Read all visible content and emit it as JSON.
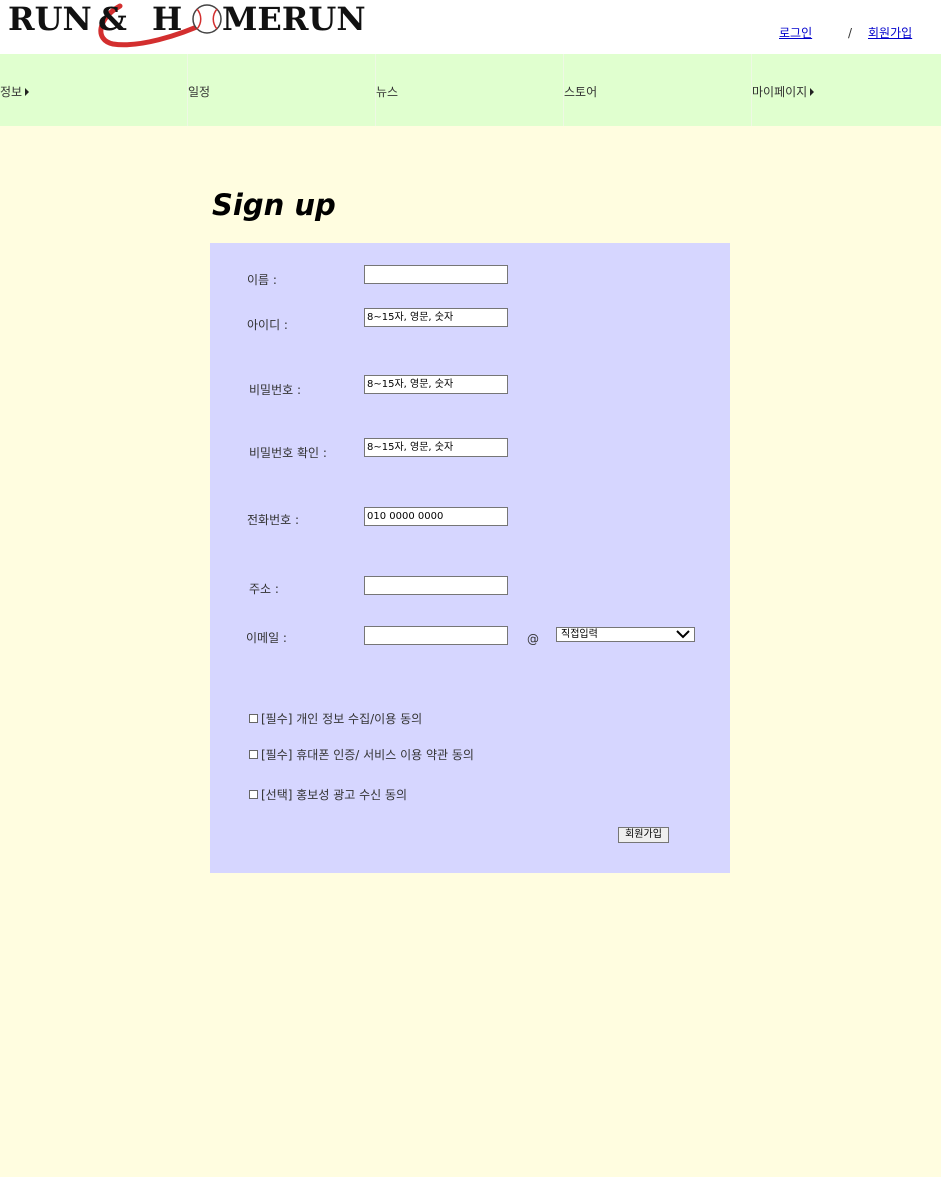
{
  "header": {
    "logo": {
      "text_left": "RUN",
      "text_amp": "&",
      "text_h": "H",
      "text_right": "MERUN",
      "accent_color": "#d32f2f"
    },
    "login_link": "로그인",
    "separator": "/",
    "signup_link": "회원가입"
  },
  "nav": {
    "items": [
      {
        "label": "정보",
        "has_submenu": true
      },
      {
        "label": "일정",
        "has_submenu": false
      },
      {
        "label": "뉴스",
        "has_submenu": false
      },
      {
        "label": "스토어",
        "has_submenu": false
      },
      {
        "label": "마이페이지",
        "has_submenu": true
      }
    ]
  },
  "page": {
    "title": "Sign up"
  },
  "form": {
    "name_label": "이름 :",
    "id_label": "아이디 :",
    "id_placeholder": "8~15자, 영문, 숫자",
    "password_label": "비밀번호 :",
    "password_placeholder": "8~15자, 영문, 숫자",
    "password_confirm_label": "비밀번호 확인 :",
    "password_confirm_placeholder": "8~15자, 영문, 숫자",
    "phone_label": "전화번호 :",
    "phone_placeholder": "010 0000 0000",
    "address_label": "주소 :",
    "email_label": "이메일 :",
    "email_at": "@",
    "email_domain_selected": "직접입력",
    "agreements": [
      "[필수] 개인 정보 수집/이용 동의",
      "[필수] 휴대폰 인증/ 서비스 이용 약관 동의",
      "[선택] 홍보성 광고 수신 동의"
    ],
    "submit_label": "회원가입"
  },
  "colors": {
    "page_background": "#fffde0",
    "nav_background": "#e0ffcf",
    "form_background": "#d6d6ff",
    "link": "#0000cc"
  }
}
